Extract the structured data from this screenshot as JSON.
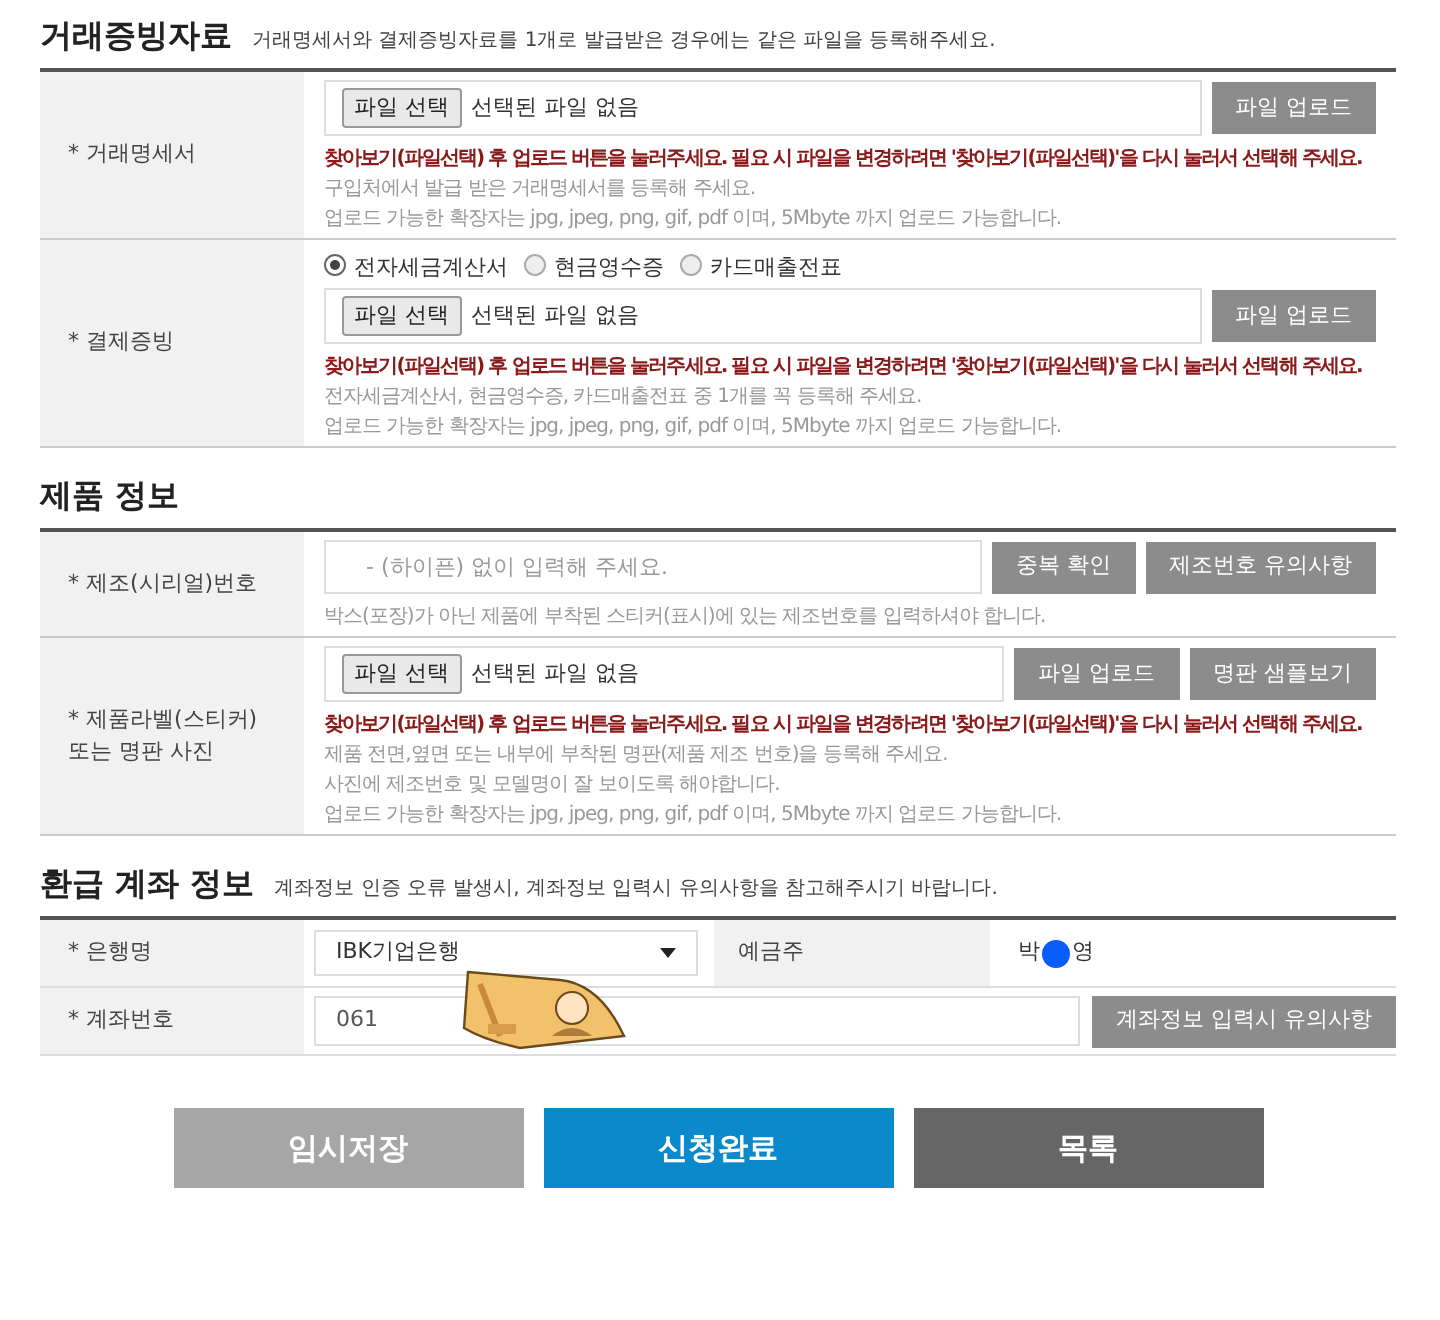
{
  "evidence": {
    "title": "거래증빙자료",
    "subtitle": "거래명세서와 결제증빙자료를 1개로 발급받은 경우에는 같은 파일을 등록해주세요.",
    "rows": [
      {
        "label": [
          "* 거래명세서"
        ],
        "field": {
          "kind": "file",
          "button": "파일 선택",
          "status": "선택된 파일 없음"
        },
        "buttons": [
          "파일 업로드"
        ],
        "notes": [
          {
            "kind": "warning",
            "text": "찾아보기(파일선택) 후 업로드 버튼을 눌러주세요. 필요 시 파일을 변경하려면 '찾아보기(파일선택)'을 다시 눌러서 선택해 주세요."
          },
          {
            "kind": "hint",
            "text": "구입처에서 발급 받은 거래명세서를 등록해 주세요."
          },
          {
            "kind": "hint",
            "text": "업로드 가능한 확장자는 jpg, jpeg, png, gif, pdf 이며, 5Mbyte 까지 업로드 가능합니다."
          }
        ]
      },
      {
        "label": [
          "* 결제증빙"
        ],
        "radios": [
          {
            "label": "전자세금계산서",
            "selected": true
          },
          {
            "label": "현금영수증",
            "selected": false
          },
          {
            "label": "카드매출전표",
            "selected": false
          }
        ],
        "field": {
          "kind": "file",
          "button": "파일 선택",
          "status": "선택된 파일 없음"
        },
        "buttons": [
          "파일 업로드"
        ],
        "notes": [
          {
            "kind": "warning",
            "text": "찾아보기(파일선택) 후 업로드 버튼을 눌러주세요. 필요 시 파일을 변경하려면 '찾아보기(파일선택)'을 다시 눌러서 선택해 주세요."
          },
          {
            "kind": "hint",
            "text": "전자세금계산서, 현금영수증, 카드매출전표 중 1개를 꼭 등록해 주세요."
          },
          {
            "kind": "hint",
            "text": "업로드 가능한 확장자는 jpg, jpeg, png, gif, pdf 이며, 5Mbyte 까지 업로드 가능합니다."
          }
        ]
      }
    ]
  },
  "product": {
    "title": "제품 정보",
    "rows": [
      {
        "label": [
          "* 제조(시리얼)번호"
        ],
        "field": {
          "kind": "text",
          "placeholder": "- (하이픈) 없이 입력해 주세요."
        },
        "buttons": [
          "중복 확인",
          "제조번호 유의사항"
        ],
        "notes": [
          {
            "kind": "hint",
            "text": "박스(포장)가 아닌 제품에 부착된 스티커(표시)에 있는 제조번호를 입력하셔야 합니다."
          }
        ]
      },
      {
        "label": [
          "* 제품라벨(스티커)",
          "또는 명판 사진"
        ],
        "field": {
          "kind": "file",
          "button": "파일 선택",
          "status": "선택된 파일 없음"
        },
        "buttons": [
          "파일 업로드",
          "명판 샘플보기"
        ],
        "notes": [
          {
            "kind": "warning",
            "text": "찾아보기(파일선택) 후 업로드 버튼을 눌러주세요. 필요 시 파일을 변경하려면 '찾아보기(파일선택)'을 다시 눌러서 선택해 주세요."
          },
          {
            "kind": "hint",
            "text": "제품 전면,옆면 또는 내부에 부착된 명판(제품 제조 번호)을 등록해 주세요."
          },
          {
            "kind": "hint",
            "text": "사진에 제조번호 및 모델명이 잘 보이도록 해야합니다."
          },
          {
            "kind": "hint",
            "text": "업로드 가능한 확장자는 jpg, jpeg, png, gif, pdf 이며, 5Mbyte 까지 업로드 가능합니다."
          }
        ]
      }
    ]
  },
  "refund": {
    "title": "환급 계좌 정보",
    "subtitle": "계좌정보 인증 오류 발생시, 계좌정보 입력시 유의사항을 참고해주시기 바랍니다.",
    "bank_label": "* 은행명",
    "bank_value": "IBK기업은행",
    "holder_label": "예금주",
    "holder_name": [
      "박",
      "영"
    ],
    "account_label": "* 계좌번호",
    "account_value": "061",
    "account_button": "계좌정보 입력시 유의사항"
  },
  "actions": [
    {
      "label": "임시저장",
      "kind": "secondary"
    },
    {
      "label": "신청완료",
      "kind": "primary"
    },
    {
      "label": "목록",
      "kind": "dark"
    }
  ]
}
